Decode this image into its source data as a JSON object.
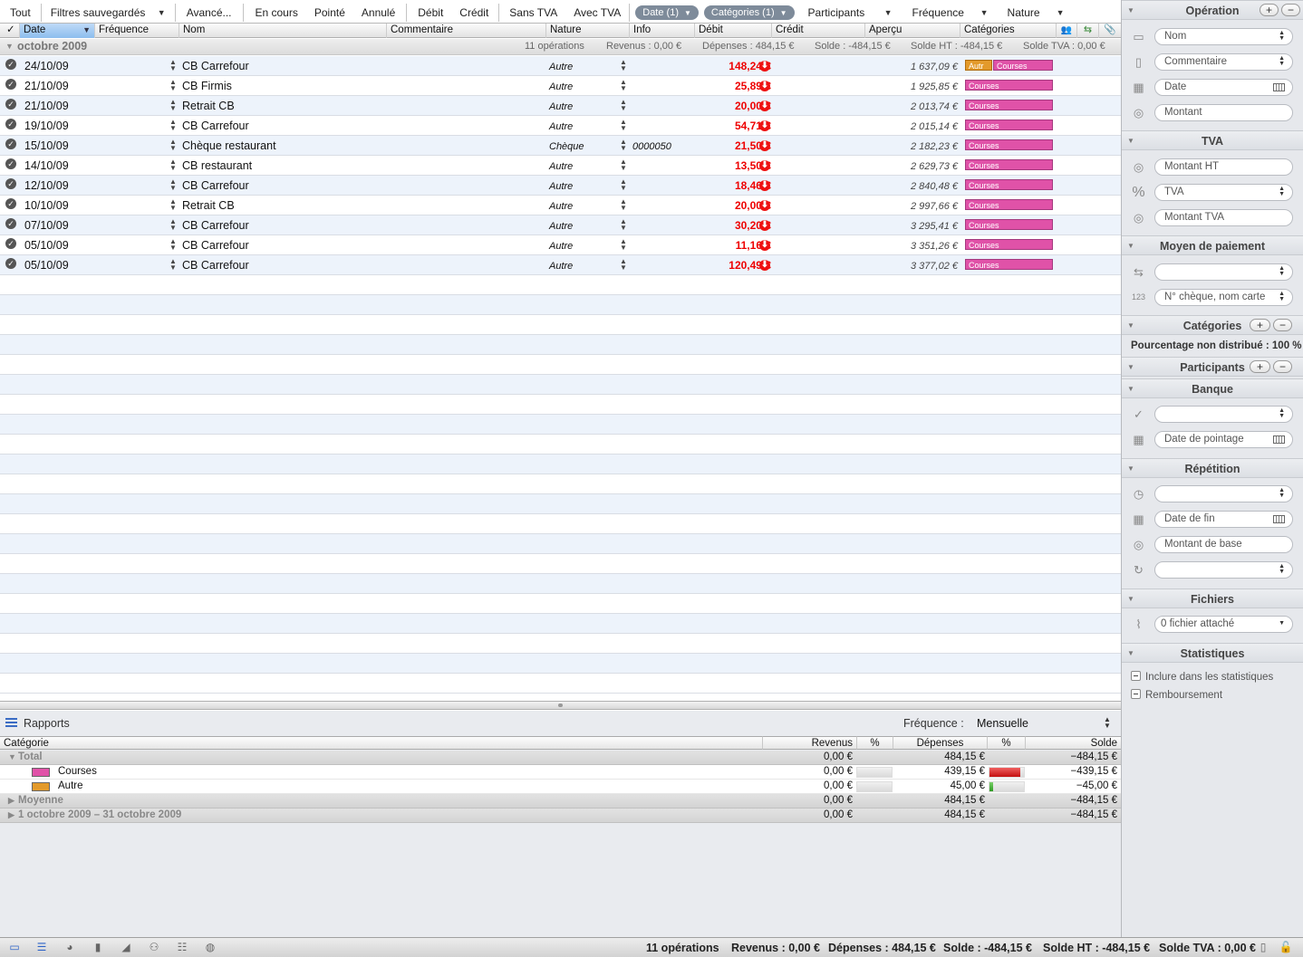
{
  "filterbar": {
    "tout": "Tout",
    "saved": "Filtres sauvegardés",
    "avance": "Avancé...",
    "en_cours": "En cours",
    "pointe": "Pointé",
    "annule": "Annulé",
    "debit": "Débit",
    "credit": "Crédit",
    "sans_tva": "Sans TVA",
    "avec_tva": "Avec TVA",
    "date_pill": "Date (1)",
    "cat_pill": "Catégories (1)",
    "participants": "Participants",
    "frequence": "Fréquence",
    "nature": "Nature"
  },
  "columns": {
    "check": "✓",
    "date": "Date",
    "frequence": "Fréquence",
    "nom": "Nom",
    "commentaire": "Commentaire",
    "nature": "Nature",
    "info": "Info",
    "debit": "Débit",
    "credit": "Crédit",
    "apercu": "Aperçu",
    "categories": "Catégories"
  },
  "group": {
    "title": "octobre 2009",
    "count": "11 opérations",
    "revenus": "Revenus : 0,00 €",
    "depenses": "Dépenses : 484,15 €",
    "solde": "Solde : -484,15 €",
    "solde_ht": "Solde HT : -484,15 €",
    "solde_tva": "Solde TVA : 0,00 €"
  },
  "transactions": [
    {
      "date": "24/10/09",
      "nom": "CB Carrefour",
      "nature": "Autre",
      "info": "",
      "debit": "148,24 €",
      "apercu": "1 637,09 €",
      "cats": [
        "Autr",
        "Courses"
      ]
    },
    {
      "date": "21/10/09",
      "nom": "CB Firmis",
      "nature": "Autre",
      "info": "",
      "debit": "25,89 €",
      "apercu": "1 925,85 €",
      "cats": [
        "Courses"
      ]
    },
    {
      "date": "21/10/09",
      "nom": "Retrait CB",
      "nature": "Autre",
      "info": "",
      "debit": "20,00 €",
      "apercu": "2 013,74 €",
      "cats": [
        "Courses"
      ]
    },
    {
      "date": "19/10/09",
      "nom": "CB Carrefour",
      "nature": "Autre",
      "info": "",
      "debit": "54,71 €",
      "apercu": "2 015,14 €",
      "cats": [
        "Courses"
      ]
    },
    {
      "date": "15/10/09",
      "nom": "Chèque restaurant",
      "nature": "Chèque",
      "info": "0000050",
      "debit": "21,50 €",
      "apercu": "2 182,23 €",
      "cats": [
        "Courses"
      ]
    },
    {
      "date": "14/10/09",
      "nom": "CB restaurant",
      "nature": "Autre",
      "info": "",
      "debit": "13,50 €",
      "apercu": "2 629,73 €",
      "cats": [
        "Courses"
      ]
    },
    {
      "date": "12/10/09",
      "nom": "CB Carrefour",
      "nature": "Autre",
      "info": "",
      "debit": "18,46 €",
      "apercu": "2 840,48 €",
      "cats": [
        "Courses"
      ]
    },
    {
      "date": "10/10/09",
      "nom": "Retrait CB",
      "nature": "Autre",
      "info": "",
      "debit": "20,00 €",
      "apercu": "2 997,66 €",
      "cats": [
        "Courses"
      ]
    },
    {
      "date": "07/10/09",
      "nom": "CB Carrefour",
      "nature": "Autre",
      "info": "",
      "debit": "30,20 €",
      "apercu": "3 295,41 €",
      "cats": [
        "Courses"
      ]
    },
    {
      "date": "05/10/09",
      "nom": "CB Carrefour",
      "nature": "Autre",
      "info": "",
      "debit": "11,16 €",
      "apercu": "3 351,26 €",
      "cats": [
        "Courses"
      ]
    },
    {
      "date": "05/10/09",
      "nom": "CB Carrefour",
      "nature": "Autre",
      "info": "",
      "debit": "120,49 €",
      "apercu": "3 377,02 €",
      "cats": [
        "Courses"
      ]
    }
  ],
  "reports": {
    "title": "Rapports",
    "freq_label": "Fréquence :",
    "freq_value": "Mensuelle",
    "headers": {
      "categorie": "Catégorie",
      "revenus": "Revenus",
      "pct1": "%",
      "depenses": "Dépenses",
      "pct2": "%",
      "solde": "Solde"
    },
    "total": {
      "label": "Total",
      "revenus": "0,00 €",
      "depenses": "484,15 €",
      "solde": "−484,15 €"
    },
    "items": [
      {
        "label": "Courses",
        "color": "#e052a8",
        "revenus": "0,00 €",
        "depenses": "439,15 €",
        "solde": "−439,15 €",
        "dep_share": 0.907
      },
      {
        "label": "Autre",
        "color": "#e39a2b",
        "revenus": "0,00 €",
        "depenses": "45,00 €",
        "solde": "−45,00 €",
        "dep_share": 0.093
      }
    ],
    "moyenne": {
      "label": "Moyenne",
      "revenus": "0,00 €",
      "depenses": "484,15 €",
      "solde": "−484,15 €"
    },
    "period": {
      "label": "1 octobre 2009 – 31 octobre 2009",
      "revenus": "0,00 €",
      "depenses": "484,15 €",
      "solde": "−484,15 €"
    }
  },
  "inspector": {
    "operation": {
      "title": "Opération",
      "nom": "Nom",
      "commentaire": "Commentaire",
      "date": "Date",
      "montant": "Montant"
    },
    "tva": {
      "title": "TVA",
      "montant_ht": "Montant HT",
      "tva": "TVA",
      "montant_tva": "Montant TVA"
    },
    "paiement": {
      "title": "Moyen de paiement",
      "numero": "N° chèque, nom carte"
    },
    "categories": {
      "title": "Catégories",
      "pct": "Pourcentage non distribué : 100 %"
    },
    "participants": {
      "title": "Participants"
    },
    "banque": {
      "title": "Banque",
      "date_pointage": "Date de pointage"
    },
    "repetition": {
      "title": "Répétition",
      "date_fin": "Date de fin",
      "montant_base": "Montant de base"
    },
    "fichiers": {
      "title": "Fichiers",
      "attache": "0 fichier attaché"
    },
    "statistiques": {
      "title": "Statistiques",
      "inclure": "Inclure dans les statistiques",
      "remboursement": "Remboursement"
    }
  },
  "status": {
    "count": "11 opérations",
    "revenus": "Revenus : 0,00 €",
    "depenses": "Dépenses : 484,15 €",
    "solde": "Solde : -484,15 €",
    "solde_ht": "Solde HT : -484,15 €",
    "solde_tva": "Solde TVA : 0,00 €"
  }
}
